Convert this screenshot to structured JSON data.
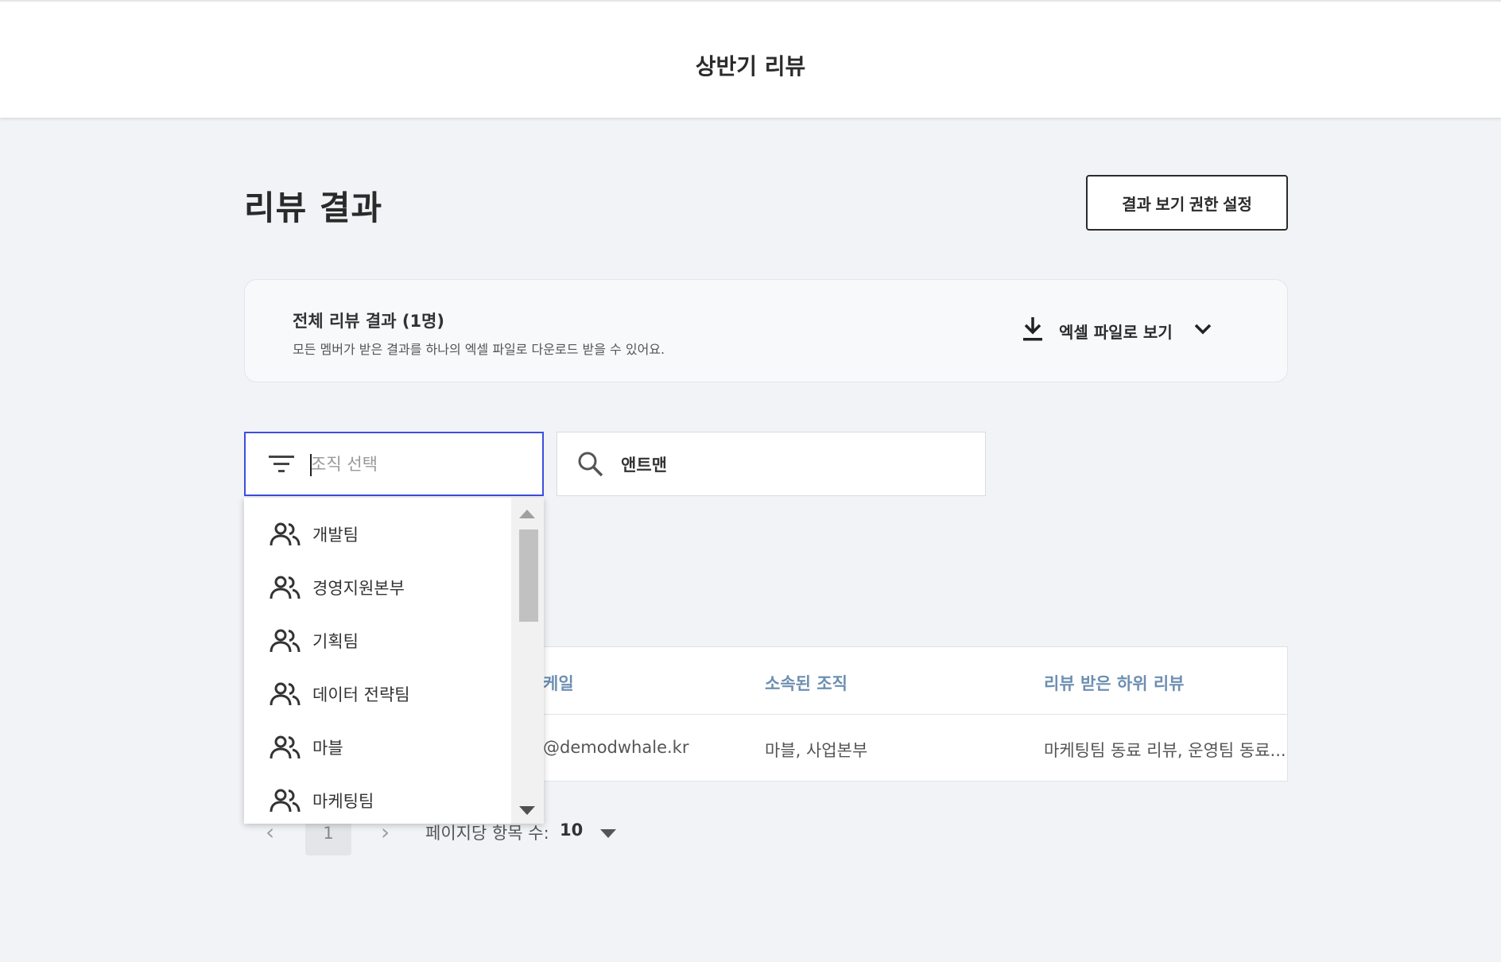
{
  "header": {
    "title": "상반기 리뷰"
  },
  "page": {
    "title": "리뷰 결과",
    "permission_button": "결과 보기 권한 설정"
  },
  "export": {
    "title": "전체 리뷰 결과 (1명)",
    "description": "모든 멤버가 받은 결과를 하나의 엑셀 파일로 다운로드 받을 수 있어요.",
    "action_label": "엑셀 파일로 보기",
    "icons": [
      "download-icon",
      "chevron-down-icon"
    ]
  },
  "filter": {
    "placeholder": "조직 선택",
    "icon": "filter-icon"
  },
  "search": {
    "value": "앤트맨",
    "icon": "search-icon"
  },
  "dropdown": {
    "items": [
      {
        "label": "개발팀",
        "icon": "group-icon"
      },
      {
        "label": "경영지원본부",
        "icon": "group-icon"
      },
      {
        "label": "기획팀",
        "icon": "group-icon"
      },
      {
        "label": "데이터 전략팀",
        "icon": "group-icon"
      },
      {
        "label": "마블",
        "icon": "group-icon"
      },
      {
        "label": "마케팅팀",
        "icon": "group-icon"
      }
    ]
  },
  "table": {
    "columns": [
      "케일",
      "소속된 조직",
      "리뷰 받은 하위 리뷰"
    ],
    "rows": [
      {
        "email": "@demodwhale.kr",
        "org": "마블, 사업본부",
        "sub_reviews": "마케팅팀 동료 리뷰, 운영팀 동료..."
      }
    ]
  },
  "pagination": {
    "current_page": "1",
    "prev_arrow": "‹",
    "next_arrow": "›",
    "per_page_label": "페이지당 항목 수:",
    "per_page_value": "10"
  },
  "colors": {
    "accent": "#3b4fe0",
    "header_text": "#6d8fb2",
    "background": "#f1f3f6"
  }
}
